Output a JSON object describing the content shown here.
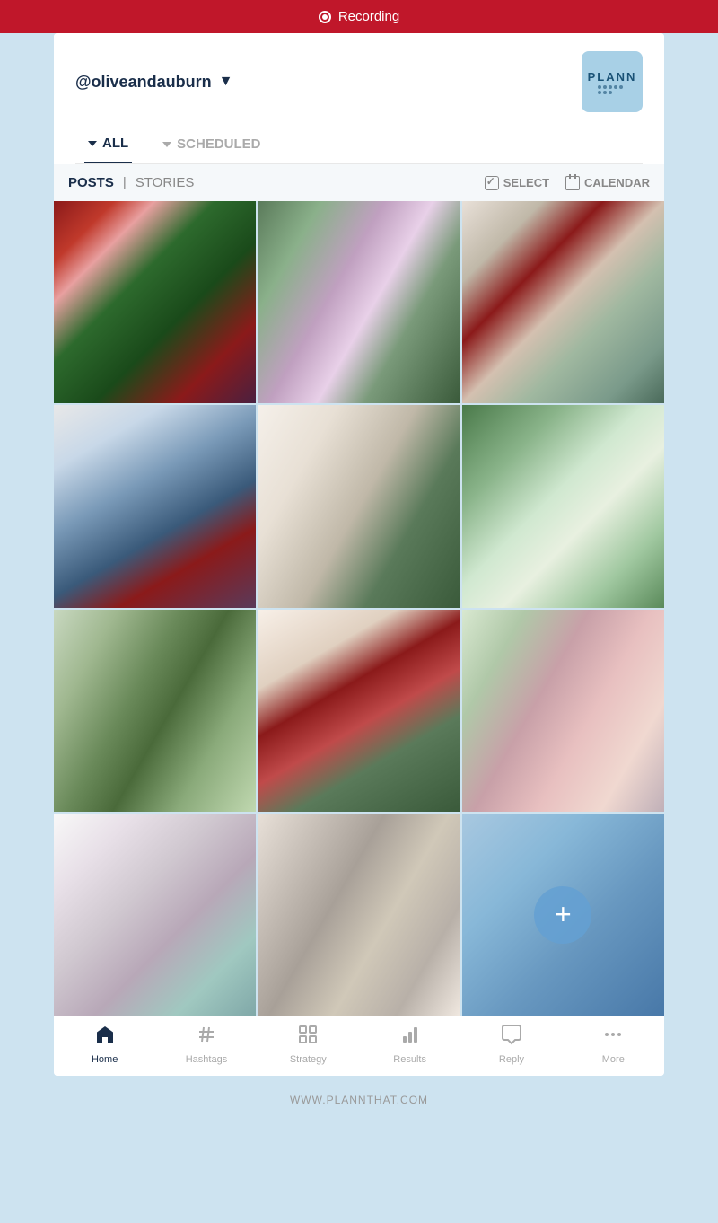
{
  "recording_bar": {
    "label": "Recording"
  },
  "header": {
    "account": "@oliveandauburn",
    "logo_text": "PLANN"
  },
  "view_tabs": [
    {
      "label": "ALL",
      "active": true
    },
    {
      "label": "SCHEDULED",
      "active": false
    }
  ],
  "content_toolbar": {
    "posts_label": "POSTS",
    "stories_label": "STORIES",
    "select_label": "SELECT",
    "calendar_label": "CALENDAR"
  },
  "photos": [
    {
      "id": 1,
      "class": "photo-1"
    },
    {
      "id": 2,
      "class": "photo-2"
    },
    {
      "id": 3,
      "class": "photo-3"
    },
    {
      "id": 4,
      "class": "photo-4"
    },
    {
      "id": 5,
      "class": "photo-5"
    },
    {
      "id": 6,
      "class": "photo-6"
    },
    {
      "id": 7,
      "class": "photo-7"
    },
    {
      "id": 8,
      "class": "photo-8"
    },
    {
      "id": 9,
      "class": "photo-9"
    },
    {
      "id": 10,
      "class": "photo-10"
    },
    {
      "id": 11,
      "class": "photo-11"
    }
  ],
  "bottom_nav": [
    {
      "key": "home",
      "label": "Home",
      "active": true,
      "icon": "home"
    },
    {
      "key": "hashtags",
      "label": "Hashtags",
      "active": false,
      "icon": "hash"
    },
    {
      "key": "strategy",
      "label": "Strategy",
      "active": false,
      "icon": "grid"
    },
    {
      "key": "results",
      "label": "Results",
      "active": false,
      "icon": "bar-chart"
    },
    {
      "key": "reply",
      "label": "Reply",
      "active": false,
      "icon": "chat"
    },
    {
      "key": "more",
      "label": "More",
      "active": false,
      "icon": "dots"
    }
  ],
  "footer": {
    "url": "WWW.PLANNTHAT.COM"
  }
}
